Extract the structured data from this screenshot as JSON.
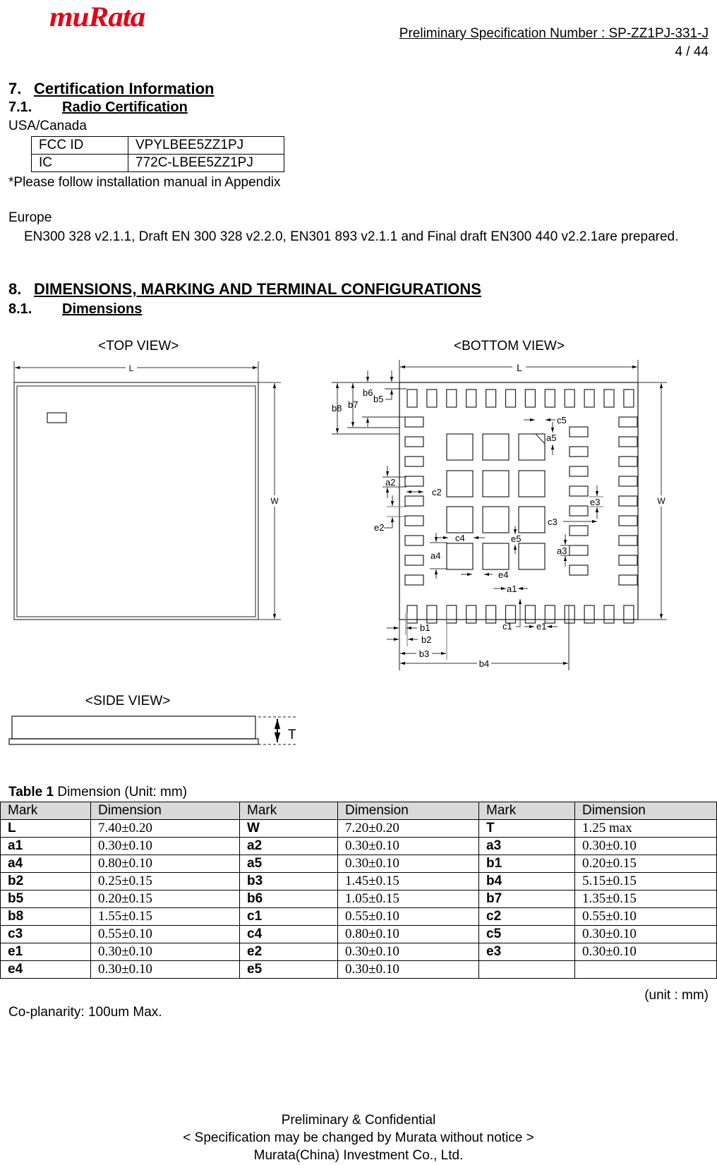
{
  "header": {
    "logo": "muRata",
    "spec_number": "Preliminary  Specification  Number  :  SP-ZZ1PJ-331-J",
    "page": "4 / 44"
  },
  "section7": {
    "num": "7.",
    "title": "Certification Information",
    "sub_num": "7.1.",
    "sub_title": "Radio Certification",
    "region_usa": "USA/Canada",
    "cert_table": [
      {
        "key": "FCC ID",
        "value": "VPYLBEE5ZZ1PJ"
      },
      {
        "key": "IC",
        "value": "772C-LBEE5ZZ1PJ"
      }
    ],
    "note": "*Please follow installation manual in Appendix",
    "region_europe": "Europe",
    "europe_text": "EN300 328 v2.1.1, Draft EN 300 328 v2.2.0, EN301 893 v2.1.1 and Final draft EN300 440 v2.2.1are prepared."
  },
  "section8": {
    "num": "8.",
    "title": "DIMENSIONS, MARKING AND TERMINAL CONFIGURATIONS",
    "sub_num": "8.1.",
    "sub_title": "Dimensions",
    "top_view_label": "<TOP VIEW>",
    "bottom_view_label": "<BOTTOM VIEW>",
    "side_view_label": "<SIDE VIEW>",
    "drawing_labels": {
      "L": "L",
      "W": "W",
      "T": "T",
      "a1": "a1",
      "a2": "a2",
      "a3": "a3",
      "a4": "a4",
      "a5": "a5",
      "b1": "b1",
      "b2": "b2",
      "b3": "b3",
      "b4": "b4",
      "b5": "b5",
      "b6": "b6",
      "b7": "b7",
      "b8": "b8",
      "c1": "c1",
      "c2": "c2",
      "c3": "c3",
      "c4": "c4",
      "c5": "c5",
      "e1": "e1",
      "e2": "e2",
      "e3": "e3",
      "e4": "e4",
      "e5": "e5"
    }
  },
  "dimension_table": {
    "caption_bold": "Table 1",
    "caption_rest": " Dimension (Unit: mm)",
    "headers": [
      "Mark",
      "Dimension",
      "Mark",
      "Dimension",
      "Mark",
      "Dimension"
    ],
    "rows": [
      [
        "L",
        "7.40±0.20",
        "W",
        "7.20±0.20",
        "T",
        "1.25 max"
      ],
      [
        "a1",
        "0.30±0.10",
        "a2",
        "0.30±0.10",
        "a3",
        "0.30±0.10"
      ],
      [
        "a4",
        "0.80±0.10",
        "a5",
        "0.30±0.10",
        "b1",
        "0.20±0.15"
      ],
      [
        "b2",
        "0.25±0.15",
        "b3",
        "1.45±0.15",
        "b4",
        "5.15±0.15"
      ],
      [
        "b5",
        "0.20±0.15",
        "b6",
        "1.05±0.15",
        "b7",
        "1.35±0.15"
      ],
      [
        "b8",
        "1.55±0.15",
        "c1",
        "0.55±0.10",
        "c2",
        "0.55±0.10"
      ],
      [
        "c3",
        "0.55±0.10",
        "c4",
        "0.80±0.10",
        "c5",
        "0.30±0.10"
      ],
      [
        "e1",
        "0.30±0.10",
        "e2",
        "0.30±0.10",
        "e3",
        "0.30±0.10"
      ],
      [
        "e4",
        "0.30±0.10",
        "e5",
        "0.30±0.10",
        "",
        ""
      ]
    ],
    "unit_note": "(unit : mm)",
    "coplanarity": "Co-planarity: 100um Max."
  },
  "footer": {
    "line1": "Preliminary & Confidential",
    "line2": "< Specification may be changed by Murata without notice >",
    "line3": "Murata(China) Investment Co., Ltd."
  }
}
